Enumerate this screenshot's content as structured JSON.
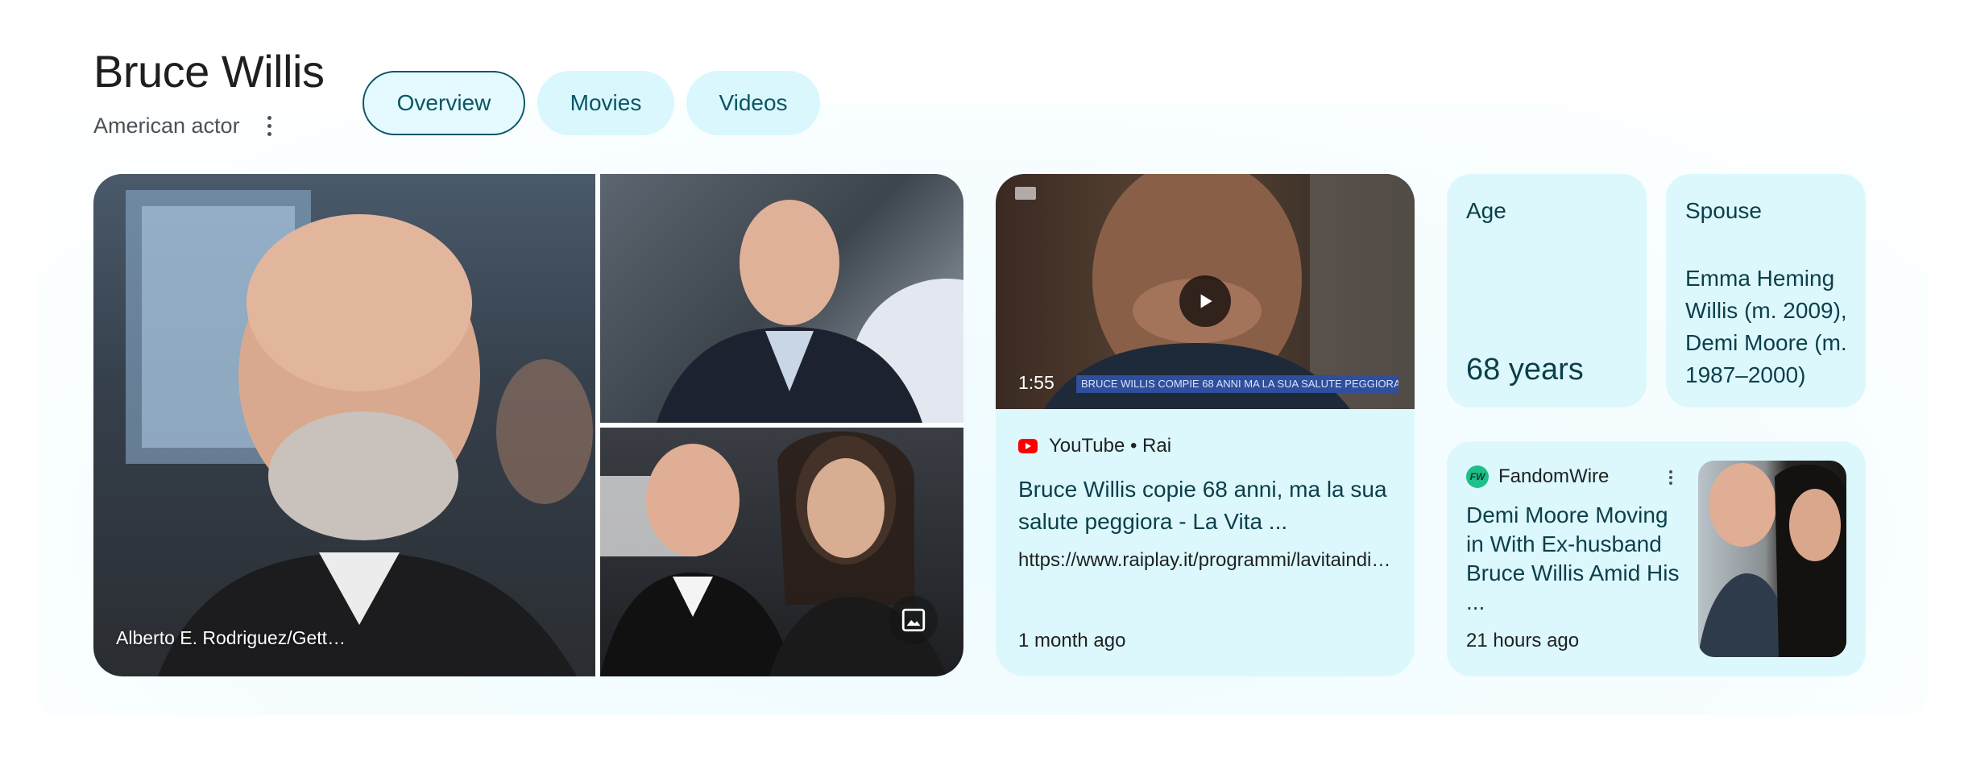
{
  "entity": {
    "name": "Bruce Willis",
    "subtitle": "American actor"
  },
  "tabs": [
    {
      "label": "Overview",
      "active": true
    },
    {
      "label": "Movies",
      "active": false
    },
    {
      "label": "Videos",
      "active": false
    }
  ],
  "photos": {
    "caption": "Alberto E. Rodriguez/Gett…"
  },
  "video": {
    "duration": "1:55",
    "ticker": "BRUCE WILLIS COMPIE 68 ANNI MA LA SUA SALUTE PEGGIORA",
    "source": "YouTube • Rai",
    "title": "Bruce Willis copie 68 anni, ma la sua salute peggiora - La Vita ...",
    "url": "https://www.raiplay.it/programmi/lavitaindiretta",
    "time": "1 month ago"
  },
  "facts": {
    "age": {
      "label": "Age",
      "value": "68 years"
    },
    "spouse": {
      "label": "Spouse",
      "value": "Emma Heming Willis (m. 2009), Demi Moore (m. 1987–2000)"
    }
  },
  "news": {
    "source": "FandomWire",
    "icon_text": "FW",
    "title": "Demi Moore Moving in With Ex-husband Bruce Willis Amid His ...",
    "time": "21 hours ago"
  },
  "colors": {
    "accent": "#0b5565",
    "card_bg": "#dcf8fd",
    "text_teal": "#0b3f4a"
  }
}
